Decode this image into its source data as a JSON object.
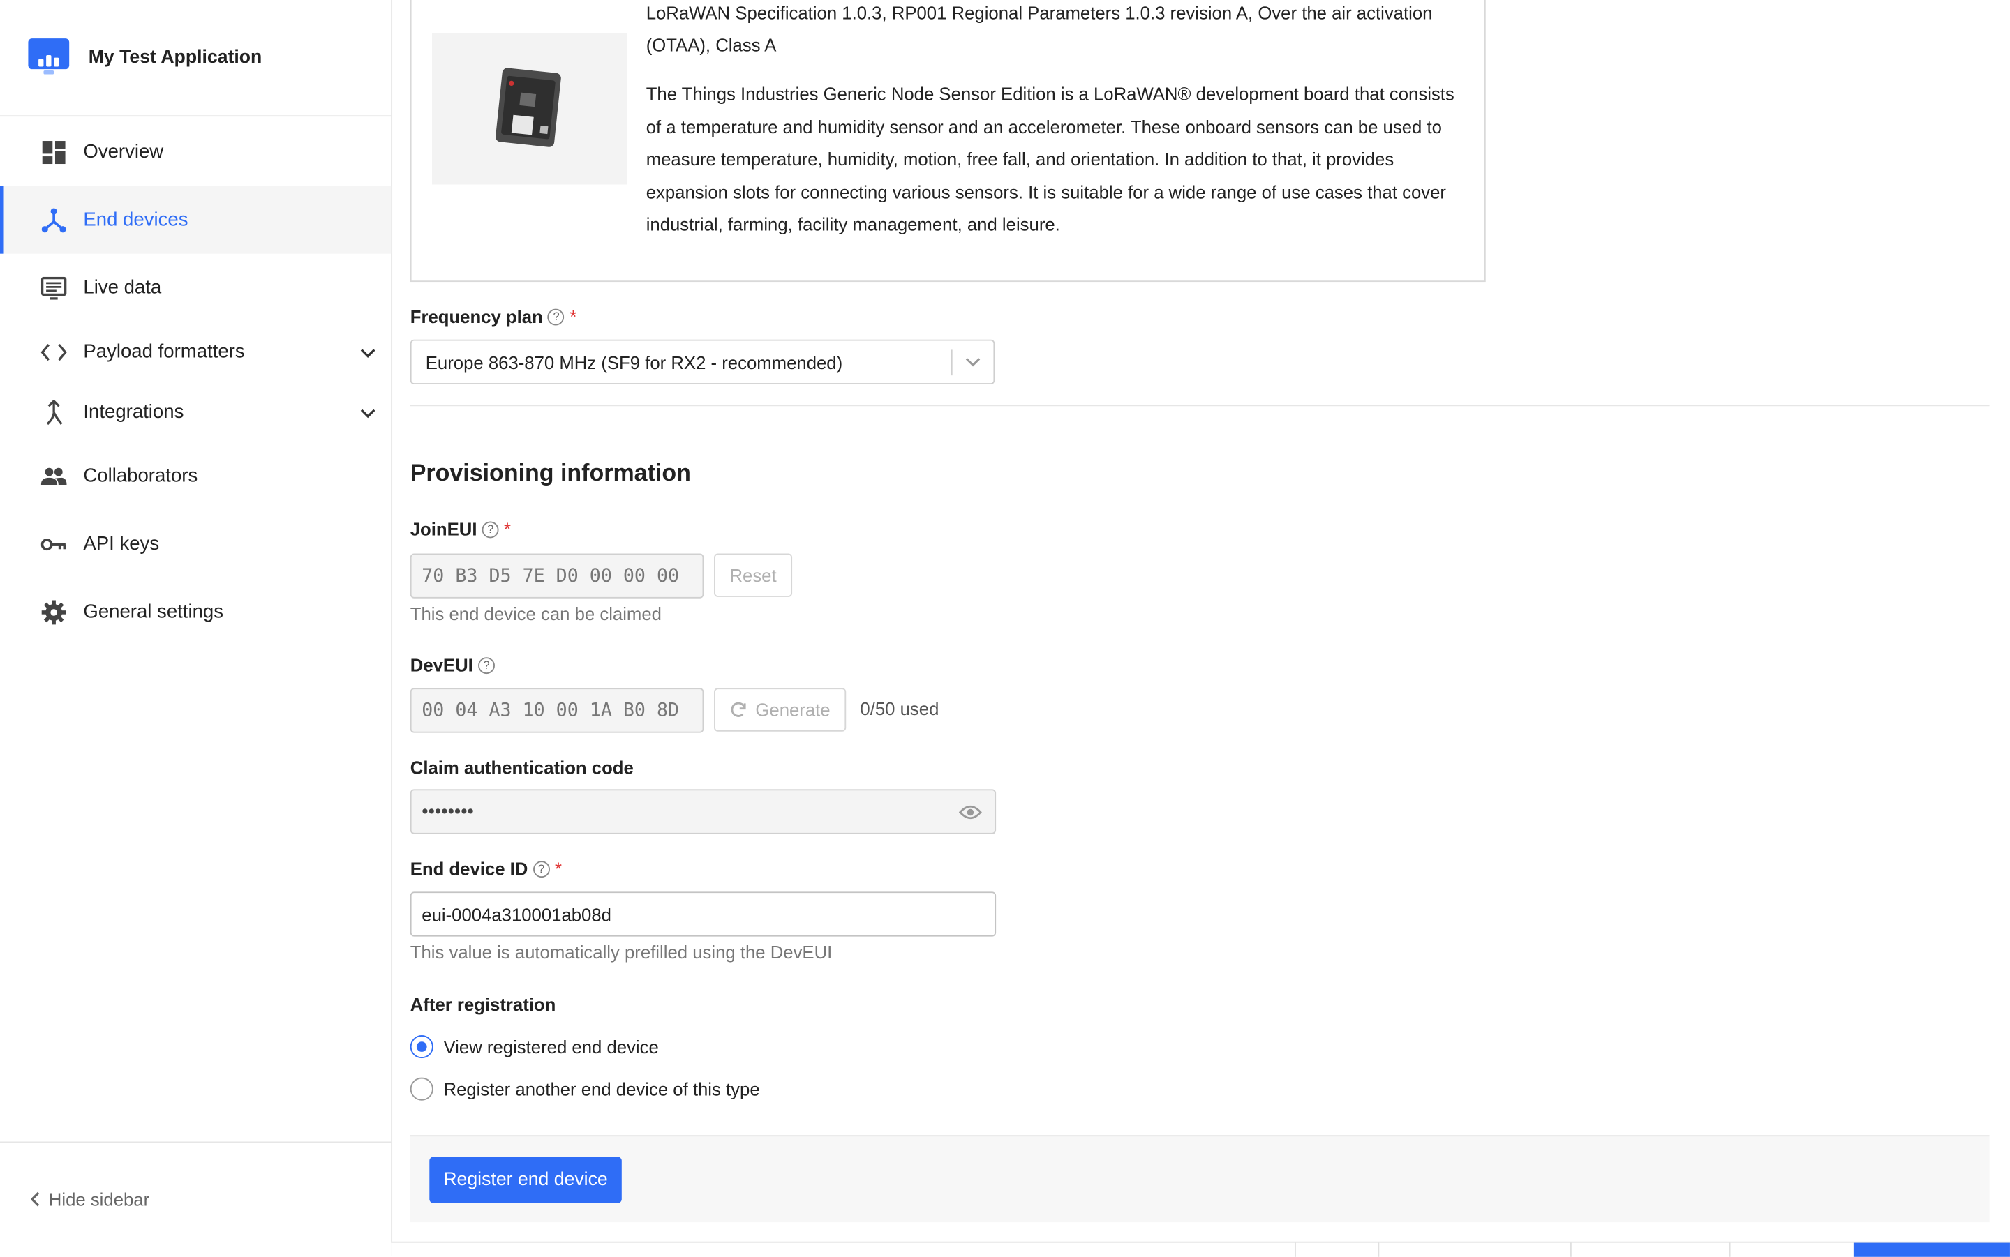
{
  "app": {
    "title": "My Test Application"
  },
  "sidebar": {
    "items": [
      {
        "label": "Overview",
        "icon": "dashboard-icon"
      },
      {
        "label": "End devices",
        "icon": "end-devices-icon",
        "active": true
      },
      {
        "label": "Live data",
        "icon": "live-data-icon"
      },
      {
        "label": "Payload formatters",
        "icon": "code-icon",
        "expandable": true
      },
      {
        "label": "Integrations",
        "icon": "integrations-icon",
        "expandable": true
      },
      {
        "label": "Collaborators",
        "icon": "people-icon"
      },
      {
        "label": "API keys",
        "icon": "key-icon"
      },
      {
        "label": "General settings",
        "icon": "gear-icon"
      }
    ],
    "hide_label": "Hide sidebar"
  },
  "device": {
    "spec": "LoRaWAN Specification 1.0.3, RP001 Regional Parameters 1.0.3 revision A, Over the air activation (OTAA), Class A",
    "description": "The Things Industries Generic Node Sensor Edition is a LoRaWAN® development board that consists of a temperature and humidity sensor and an accelerometer. These onboard sensors can be used to measure temperature, humidity, motion, free fall, and orientation. In addition to that, it provides expansion slots for connecting various sensors. It is suitable for a wide range of use cases that cover industrial, farming, facility management, and leisure."
  },
  "frequency_plan": {
    "label": "Frequency plan",
    "value": "Europe 863-870 MHz (SF9 for RX2 - recommended)"
  },
  "provisioning": {
    "title": "Provisioning information",
    "join_eui": {
      "label": "JoinEUI",
      "value": "70 B3 D5 7E D0 00 00 00",
      "reset_label": "Reset",
      "hint": "This end device can be claimed"
    },
    "dev_eui": {
      "label": "DevEUI",
      "value": "00 04 A3 10 00 1A B0 8D",
      "generate_label": "Generate",
      "usage": "0/50 used"
    },
    "claim_code": {
      "label": "Claim authentication code",
      "value": "••••••••"
    },
    "device_id": {
      "label": "End device ID",
      "value": "eui-0004a310001ab08d",
      "hint": "This value is automatically prefilled using the DevEUI"
    }
  },
  "after_registration": {
    "label": "After registration",
    "options": [
      {
        "label": "View registered end device",
        "checked": true
      },
      {
        "label": "Register another end device of this type",
        "checked": false
      }
    ]
  },
  "submit": {
    "label": "Register end device"
  },
  "colors": {
    "accent": "#2f6df6",
    "required": "#e03434"
  }
}
